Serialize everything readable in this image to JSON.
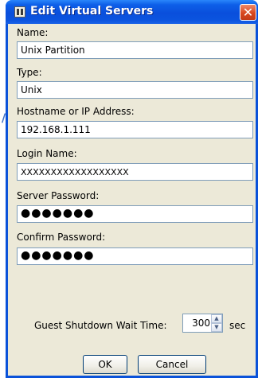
{
  "window": {
    "title": "Edit Virtual Servers",
    "close_glyph": "✕"
  },
  "background": {
    "glyph": "/"
  },
  "form": {
    "name": {
      "label": "Name:",
      "value": "Unix Partition"
    },
    "type": {
      "label": "Type:",
      "value": "Unix"
    },
    "hostname": {
      "label": "Hostname or IP Address:",
      "value": "192.168.1.111"
    },
    "login": {
      "label": "Login Name:",
      "value": "XXXXXXXXXXXXXXXXXX"
    },
    "server_password": {
      "label": "Server Password:",
      "value": "●●●●●●●"
    },
    "confirm_password": {
      "label": "Confirm Password:",
      "value": "●●●●●●●"
    },
    "guest_shutdown": {
      "label": "Guest Shutdown Wait Time:",
      "value": "300",
      "unit": "sec"
    }
  },
  "buttons": {
    "ok": "OK",
    "cancel": "Cancel"
  },
  "icons": {
    "app": "app-server-icon",
    "close": "close-icon",
    "spin_up": "spinner-up-icon",
    "spin_down": "spinner-down-icon"
  },
  "colors": {
    "titlebar": "#0a4fdc",
    "window_bg": "#ece9d8",
    "close": "#d8471f"
  }
}
